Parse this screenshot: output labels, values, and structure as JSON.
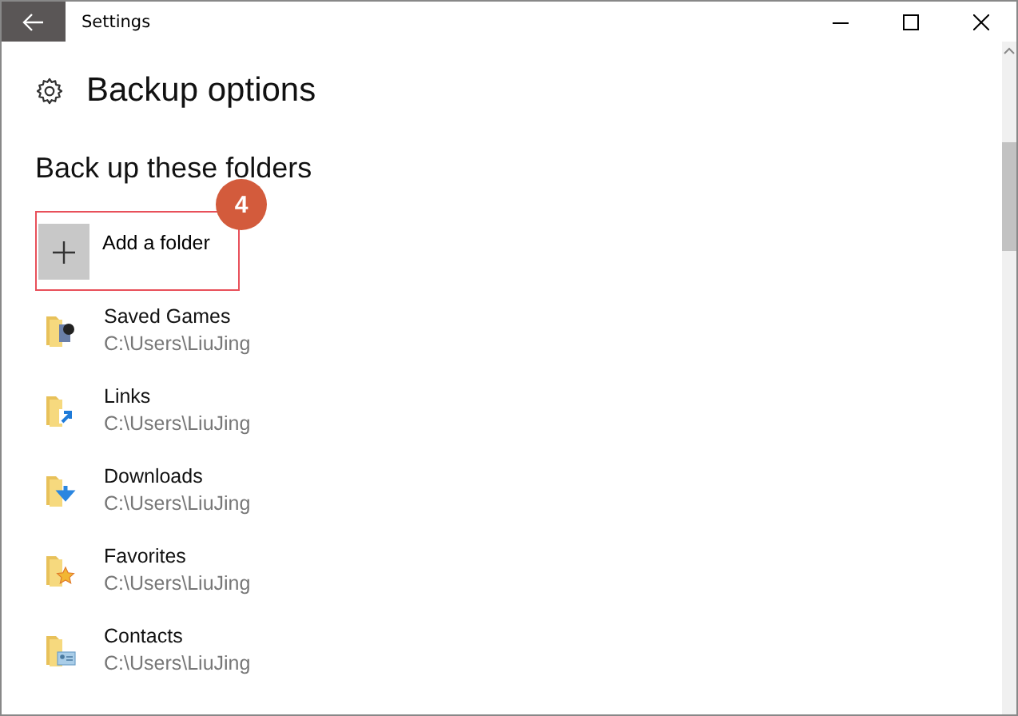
{
  "window": {
    "title": "Settings"
  },
  "page": {
    "title": "Backup options"
  },
  "section": {
    "title": "Back up these folders"
  },
  "add_button": {
    "label": "Add a folder",
    "highlighted": true,
    "step": "4"
  },
  "folders": [
    {
      "name": "Saved Games",
      "path": "C:\\Users\\LiuJing",
      "kind": "game"
    },
    {
      "name": "Links",
      "path": "C:\\Users\\LiuJing",
      "kind": "link"
    },
    {
      "name": "Downloads",
      "path": "C:\\Users\\LiuJing",
      "kind": "download"
    },
    {
      "name": "Favorites",
      "path": "C:\\Users\\LiuJing",
      "kind": "star"
    },
    {
      "name": "Contacts",
      "path": "C:\\Users\\LiuJing",
      "kind": "contact"
    }
  ]
}
